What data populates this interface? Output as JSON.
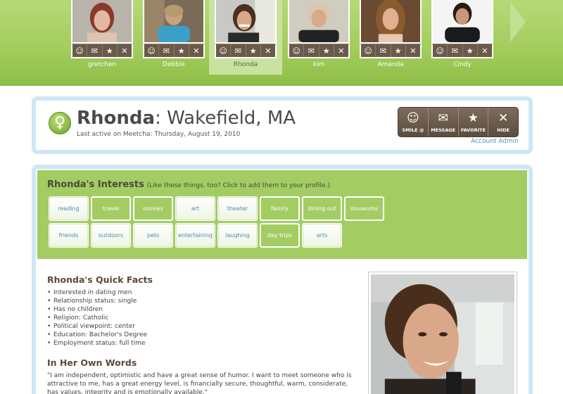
{
  "thumbnails": [
    {
      "name": "gretchen",
      "selected": false
    },
    {
      "name": "Debbie",
      "selected": false
    },
    {
      "name": "Rhonda",
      "selected": true
    },
    {
      "name": "kim",
      "selected": false
    },
    {
      "name": "Amanda",
      "selected": false
    },
    {
      "name": "Cindy",
      "selected": false
    }
  ],
  "thumb_actions": [
    "smile-icon",
    "message-icon",
    "favorite-icon",
    "hide-icon"
  ],
  "profile": {
    "name": "Rhonda",
    "location": "Wakefield, MA",
    "last_active": "Last active on Meetcha: Thursday, August 19, 2010"
  },
  "actions": {
    "smile": "SMILE @",
    "message": "MESSAGE",
    "favorite": "FAVORITE",
    "hide": "HIDE"
  },
  "account_admin": "Account Admin",
  "interests": {
    "title": "Rhonda's Interests",
    "subtitle": "(Like these things, too? Click to add them to your profile.)",
    "row1": [
      {
        "label": "reading",
        "active": false
      },
      {
        "label": "travel",
        "active": true
      },
      {
        "label": "movies",
        "active": true
      },
      {
        "label": "art",
        "active": false
      },
      {
        "label": "theater",
        "active": false
      },
      {
        "label": "family",
        "active": true
      },
      {
        "label": "dining out",
        "active": true
      },
      {
        "label": "museums",
        "active": true
      }
    ],
    "row2": [
      {
        "label": "friends",
        "active": false
      },
      {
        "label": "outdoors",
        "active": false
      },
      {
        "label": "pets",
        "active": false
      },
      {
        "label": "entertaining",
        "active": false
      },
      {
        "label": "laughing",
        "active": false
      },
      {
        "label": "day trips",
        "active": true
      },
      {
        "label": "arts",
        "active": false
      }
    ]
  },
  "quick_facts": {
    "title": "Rhonda's Quick Facts",
    "items": [
      "Interested in dating men",
      "Relationship status: single",
      "Has no children",
      "Religion: Catholic",
      "Political viewpoint: center",
      "Education: Bachelor's Degree",
      "Employment status: full time"
    ]
  },
  "own_words": {
    "title": "In Her Own Words",
    "text": "\"I am independent, optimistic and have a great sense of humor. I want to meet someone who is attractive to me, has a great energy level, is financially secure, thoughtful, warm, considerate, has values, integrity and is emotionally available.\""
  },
  "colors": {
    "brand_green": "#a3cc63",
    "action_brown": "#6b5a4a",
    "frame_blue": "#cfe7f4",
    "link_blue": "#4a90c0"
  }
}
